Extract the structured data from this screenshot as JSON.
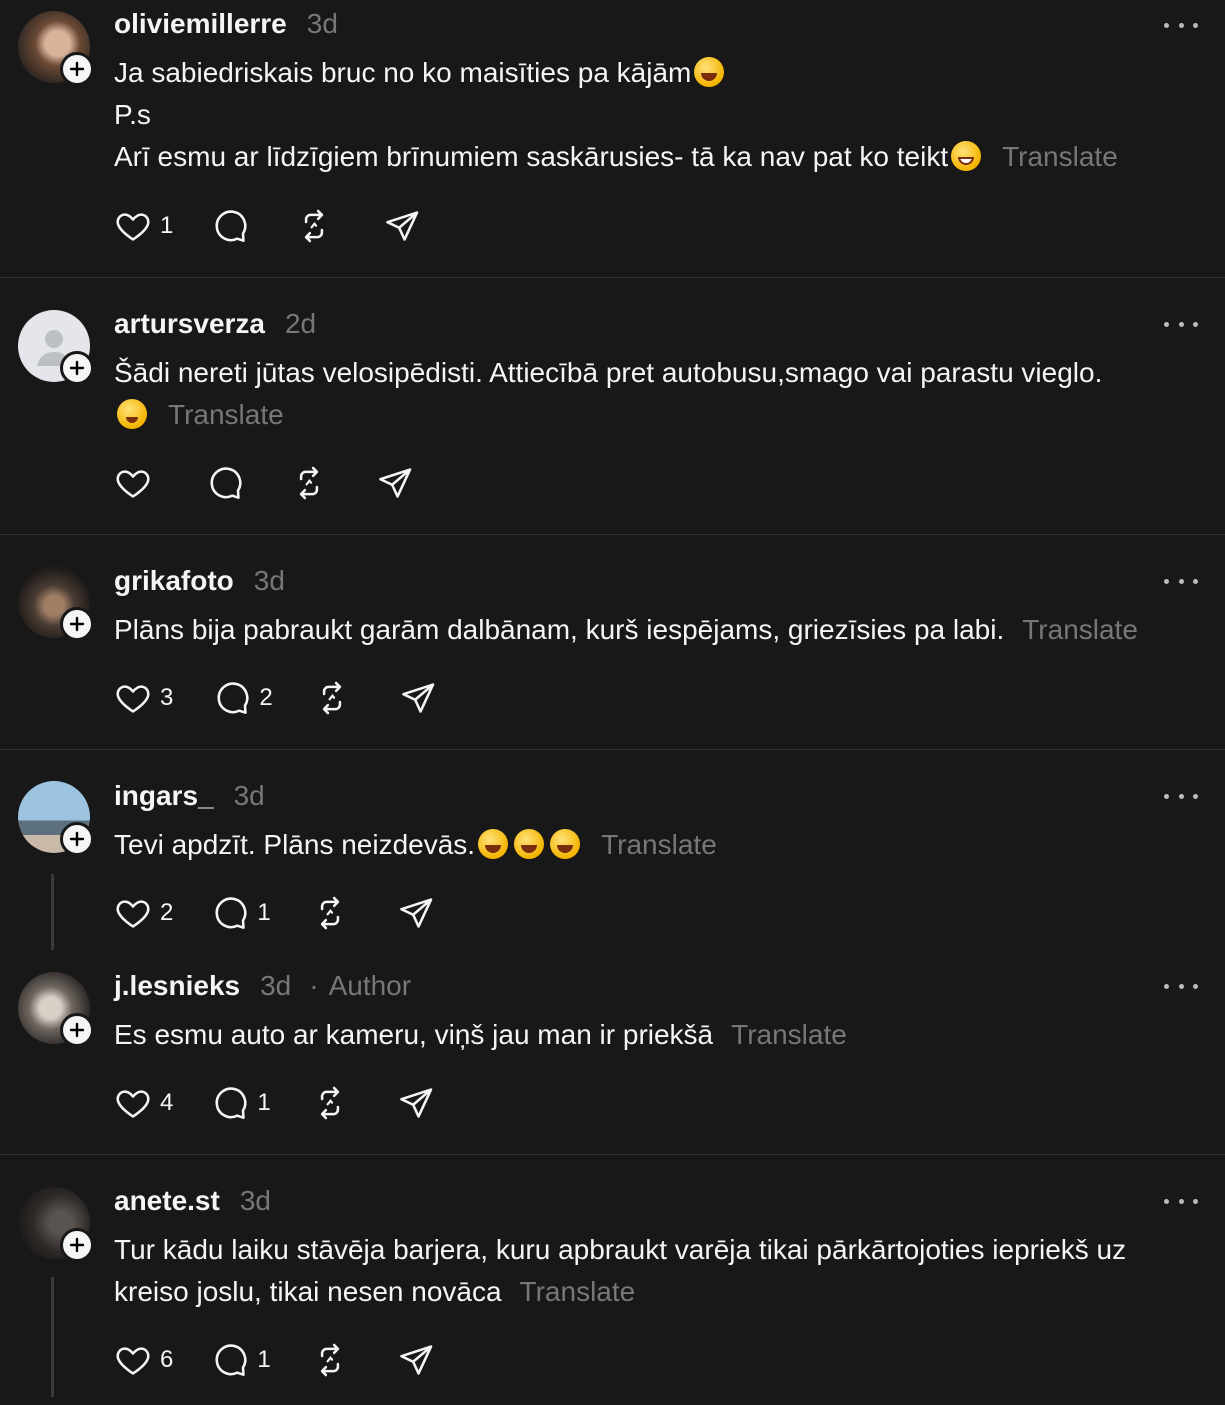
{
  "posts": [
    {
      "username": "oliviemillerre",
      "time": "3d",
      "lines": [
        "Ja sabiedriskais bruc no ko maisīties pa kājām",
        "P.s",
        "Arī esmu ar līdzīgiem brīnumiem saskārusies- tā ka nav pat ko teikt"
      ],
      "translate": "Translate",
      "likes": "1",
      "replies": ""
    },
    {
      "username": "artursverza",
      "time": "2d",
      "lines": [
        "Šādi nereti jūtas velosipēdisti. Attiecībā pret autobusu,smago vai parastu vieglo."
      ],
      "translate": "Translate",
      "likes": "",
      "replies": ""
    },
    {
      "username": "grikafoto",
      "time": "3d",
      "lines": [
        "Plāns bija pabraukt garām dalbānam, kurš iespējams, griezīsies pa labi."
      ],
      "translate": "Translate",
      "likes": "3",
      "replies": "2"
    },
    {
      "username": "ingars_",
      "time": "3d",
      "lines": [
        "Tevi apdzīt. Plāns neizdevās."
      ],
      "translate": "Translate",
      "likes": "2",
      "replies": "1"
    },
    {
      "username": "j.lesnieks",
      "time": "3d",
      "role_dot": "·",
      "role": "Author",
      "lines": [
        "Es esmu auto ar kameru, viņš jau man ir priekšā"
      ],
      "translate": "Translate",
      "likes": "4",
      "replies": "1"
    },
    {
      "username": "anete.st",
      "time": "3d",
      "lines": [
        "Tur kādu laiku stāvēja barjera, kuru apbraukt varēja tikai pārkārtojoties iepriekš uz",
        "kreiso joslu, tikai nesen novāca"
      ],
      "translate": "Translate",
      "likes": "6",
      "replies": "1"
    }
  ]
}
